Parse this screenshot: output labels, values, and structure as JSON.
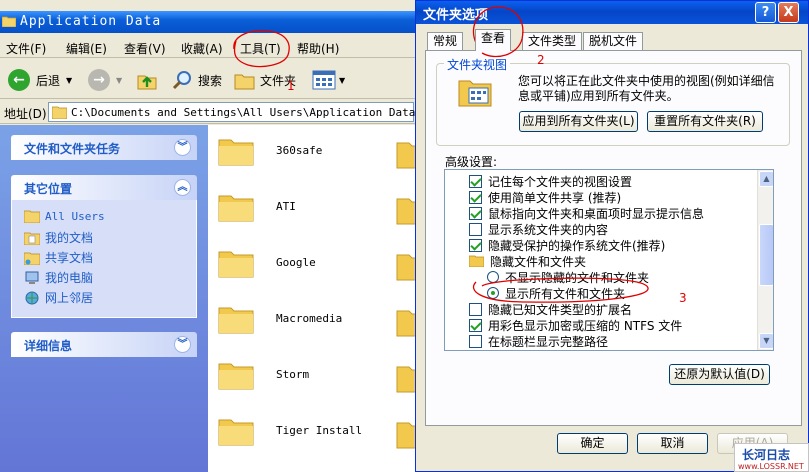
{
  "explorer": {
    "title": "Application Data",
    "menu": [
      "文件(F)",
      "编辑(E)",
      "查看(V)",
      "收藏(A)",
      "工具(T)",
      "帮助(H)"
    ],
    "toolbar": {
      "back": "后退",
      "search": "搜索",
      "folders": "文件夹"
    },
    "address_label": "地址(D)",
    "address_value": "C:\\Documents and Settings\\All Users\\Application Data",
    "task_pane": {
      "file_tasks": "文件和文件夹任务",
      "other_places": "其它位置",
      "places": [
        "All Users",
        "我的文档",
        "共享文档",
        "我的电脑",
        "网上邻居"
      ],
      "details": "详细信息"
    },
    "folders": [
      "360safe",
      "ATI",
      "Google",
      "Macromedia",
      "Storm",
      "Tiger Install"
    ]
  },
  "dialog": {
    "title": "文件夹选项",
    "help_glyph": "?",
    "close_glyph": "X",
    "tabs": [
      "常规",
      "查看",
      "文件类型",
      "脱机文件"
    ],
    "active_tab": 1,
    "folder_views": {
      "legend": "文件夹视图",
      "description": "您可以将正在此文件夹中使用的视图(例如详细信息或平铺)应用到所有文件夹。",
      "apply_all": "应用到所有文件夹(L)",
      "reset_all": "重置所有文件夹(R)"
    },
    "advanced_label": "高级设置:",
    "settings": [
      {
        "type": "checkbox",
        "checked": true,
        "indent": 1,
        "label": "记住每个文件夹的视图设置"
      },
      {
        "type": "checkbox",
        "checked": true,
        "indent": 1,
        "label": "使用简单文件共享 (推荐)"
      },
      {
        "type": "checkbox",
        "checked": true,
        "indent": 1,
        "label": "鼠标指向文件夹和桌面项时显示提示信息"
      },
      {
        "type": "checkbox",
        "checked": false,
        "indent": 1,
        "label": "显示系统文件夹的内容"
      },
      {
        "type": "checkbox",
        "checked": true,
        "indent": 1,
        "label": "隐藏受保护的操作系统文件(推荐)"
      },
      {
        "type": "folder",
        "checked": false,
        "indent": 1,
        "label": "隐藏文件和文件夹"
      },
      {
        "type": "radio",
        "checked": false,
        "indent": 2,
        "label": "不显示隐藏的文件和文件夹"
      },
      {
        "type": "radio",
        "checked": true,
        "indent": 2,
        "label": "显示所有文件和文件夹"
      },
      {
        "type": "checkbox",
        "checked": false,
        "indent": 1,
        "label": "隐藏已知文件类型的扩展名"
      },
      {
        "type": "checkbox",
        "checked": true,
        "indent": 1,
        "label": "用彩色显示加密或压缩的 NTFS 文件"
      },
      {
        "type": "checkbox",
        "checked": false,
        "indent": 1,
        "label": "在标题栏显示完整路径"
      }
    ],
    "restore_defaults": "还原为默认值(D)",
    "ok": "确定",
    "cancel": "取消",
    "apply": "应用(A)"
  },
  "annotations": {
    "n1": "1",
    "n2": "2",
    "n3": "3"
  },
  "watermark": {
    "main": "长河日志",
    "sub": "www.LOSSR.NET"
  },
  "colors": {
    "xp_blue": "#0a5fd8",
    "link_blue": "#215dc6",
    "annotation_red": "#e00000"
  }
}
